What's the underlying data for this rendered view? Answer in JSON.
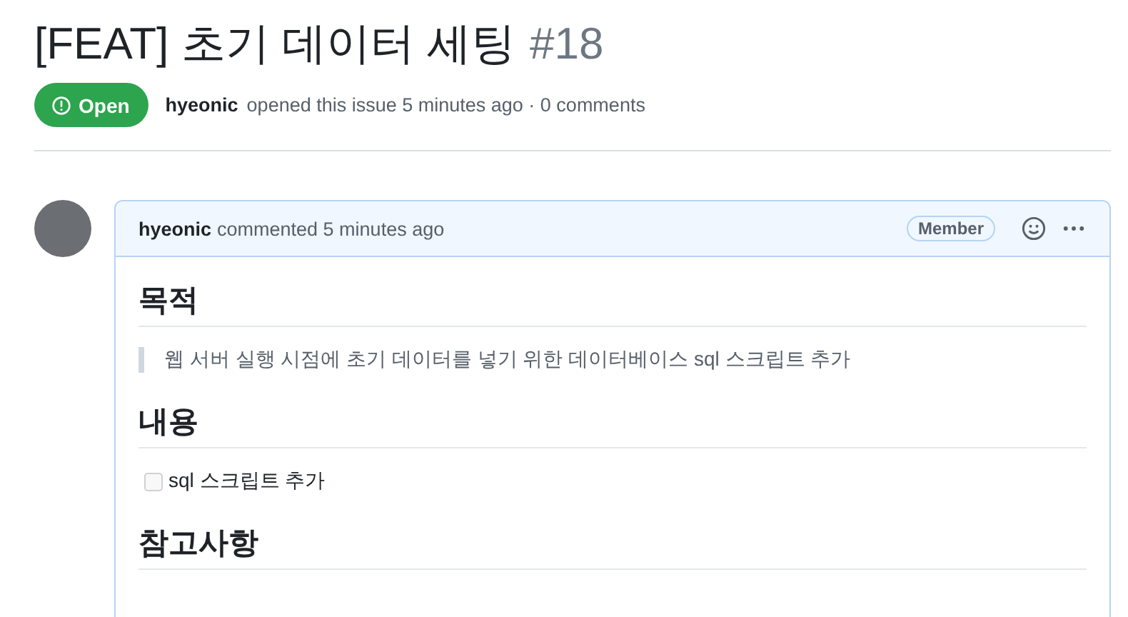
{
  "issue": {
    "title": "[FEAT] 초기 데이터 세팅",
    "number": "#18",
    "status": "Open",
    "author": "hyeonic",
    "summary": "opened this issue 5 minutes ago · 0 comments"
  },
  "comment": {
    "author": "hyeonic",
    "meta": "commented 5 minutes ago",
    "role": "Member",
    "body": [
      {
        "kind": "heading",
        "text": "목적"
      },
      {
        "kind": "quote",
        "text": "웹 서버 실행 시점에 초기 데이터를 넣기 위한 데이터베이스 sql 스크립트 추가"
      },
      {
        "kind": "heading",
        "text": "내용"
      },
      {
        "kind": "task",
        "text": "sql 스크립트 추가",
        "checked": false
      },
      {
        "kind": "heading",
        "text": "참고사항"
      }
    ]
  }
}
